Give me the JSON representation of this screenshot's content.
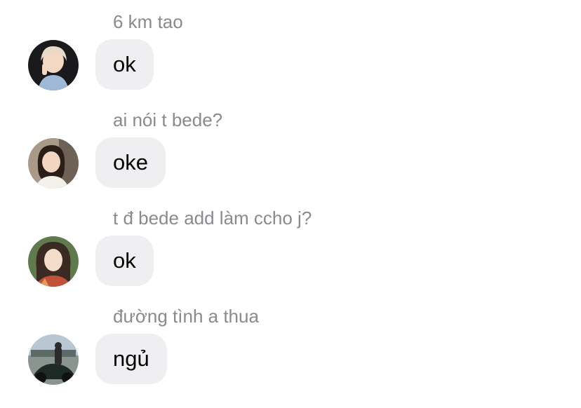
{
  "messages": [
    {
      "reply_to": "6 km tao",
      "text": "ok",
      "avatar_icon": "user-avatar-1"
    },
    {
      "reply_to": "ai nói t bede?",
      "text": "oke",
      "avatar_icon": "user-avatar-2"
    },
    {
      "reply_to": "t đ bede add làm ccho j?",
      "text": "ok",
      "avatar_icon": "user-avatar-3"
    },
    {
      "reply_to": "đường tình a thua",
      "text": "ngủ",
      "avatar_icon": "user-avatar-4"
    }
  ],
  "colors": {
    "bubble": "#efeff1",
    "reply_text": "#8a8a8e",
    "message_text": "#000000"
  }
}
